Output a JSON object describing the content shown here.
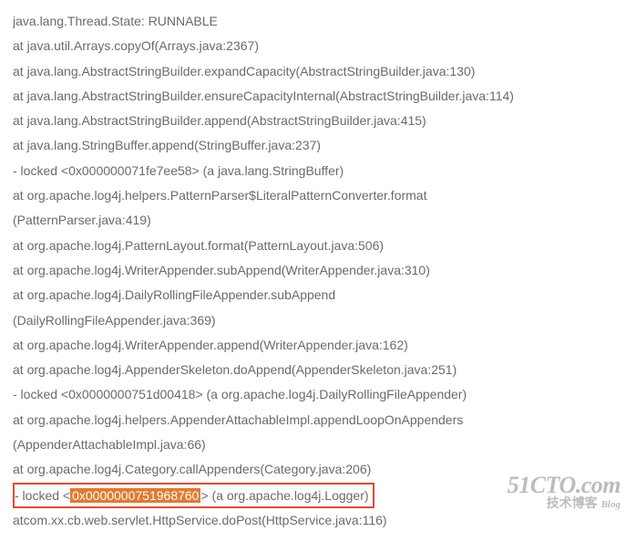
{
  "lines": [
    "java.lang.Thread.State: RUNNABLE",
    "at java.util.Arrays.copyOf(Arrays.java:2367)",
    "at java.lang.AbstractStringBuilder.expandCapacity(AbstractStringBuilder.java:130)",
    "at java.lang.AbstractStringBuilder.ensureCapacityInternal(AbstractStringBuilder.java:114)",
    "at java.lang.AbstractStringBuilder.append(AbstractStringBuilder.java:415)",
    "at java.lang.StringBuffer.append(StringBuffer.java:237)",
    "- locked <0x000000071fe7ee58> (a java.lang.StringBuffer)",
    "at org.apache.log4j.helpers.PatternParser$LiteralPatternConverter.format",
    "(PatternParser.java:419)",
    "at org.apache.log4j.PatternLayout.format(PatternLayout.java:506)",
    "at org.apache.log4j.WriterAppender.subAppend(WriterAppender.java:310)",
    "at org.apache.log4j.DailyRollingFileAppender.subAppend",
    "(DailyRollingFileAppender.java:369)",
    "at org.apache.log4j.WriterAppender.append(WriterAppender.java:162)",
    "at org.apache.log4j.AppenderSkeleton.doAppend(AppenderSkeleton.java:251)",
    "- locked <0x0000000751d00418> (a org.apache.log4j.DailyRollingFileAppender)",
    "at org.apache.log4j.helpers.AppenderAttachableImpl.appendLoopOnAppenders",
    "(AppenderAttachableImpl.java:66)",
    "at org.apache.log4j.Category.callAppenders(Category.java:206)"
  ],
  "highlight": {
    "pre": " - locked <",
    "hl": "0x0000000751968760",
    "post": "> (a org.apache.log4j.Logger) "
  },
  "last_line": "atcom.xx.cb.web.servlet.HttpService.doPost(HttpService.java:116)",
  "watermark": {
    "top": "51CTO.com",
    "bot": "技术博客",
    "blog": "Blog"
  }
}
